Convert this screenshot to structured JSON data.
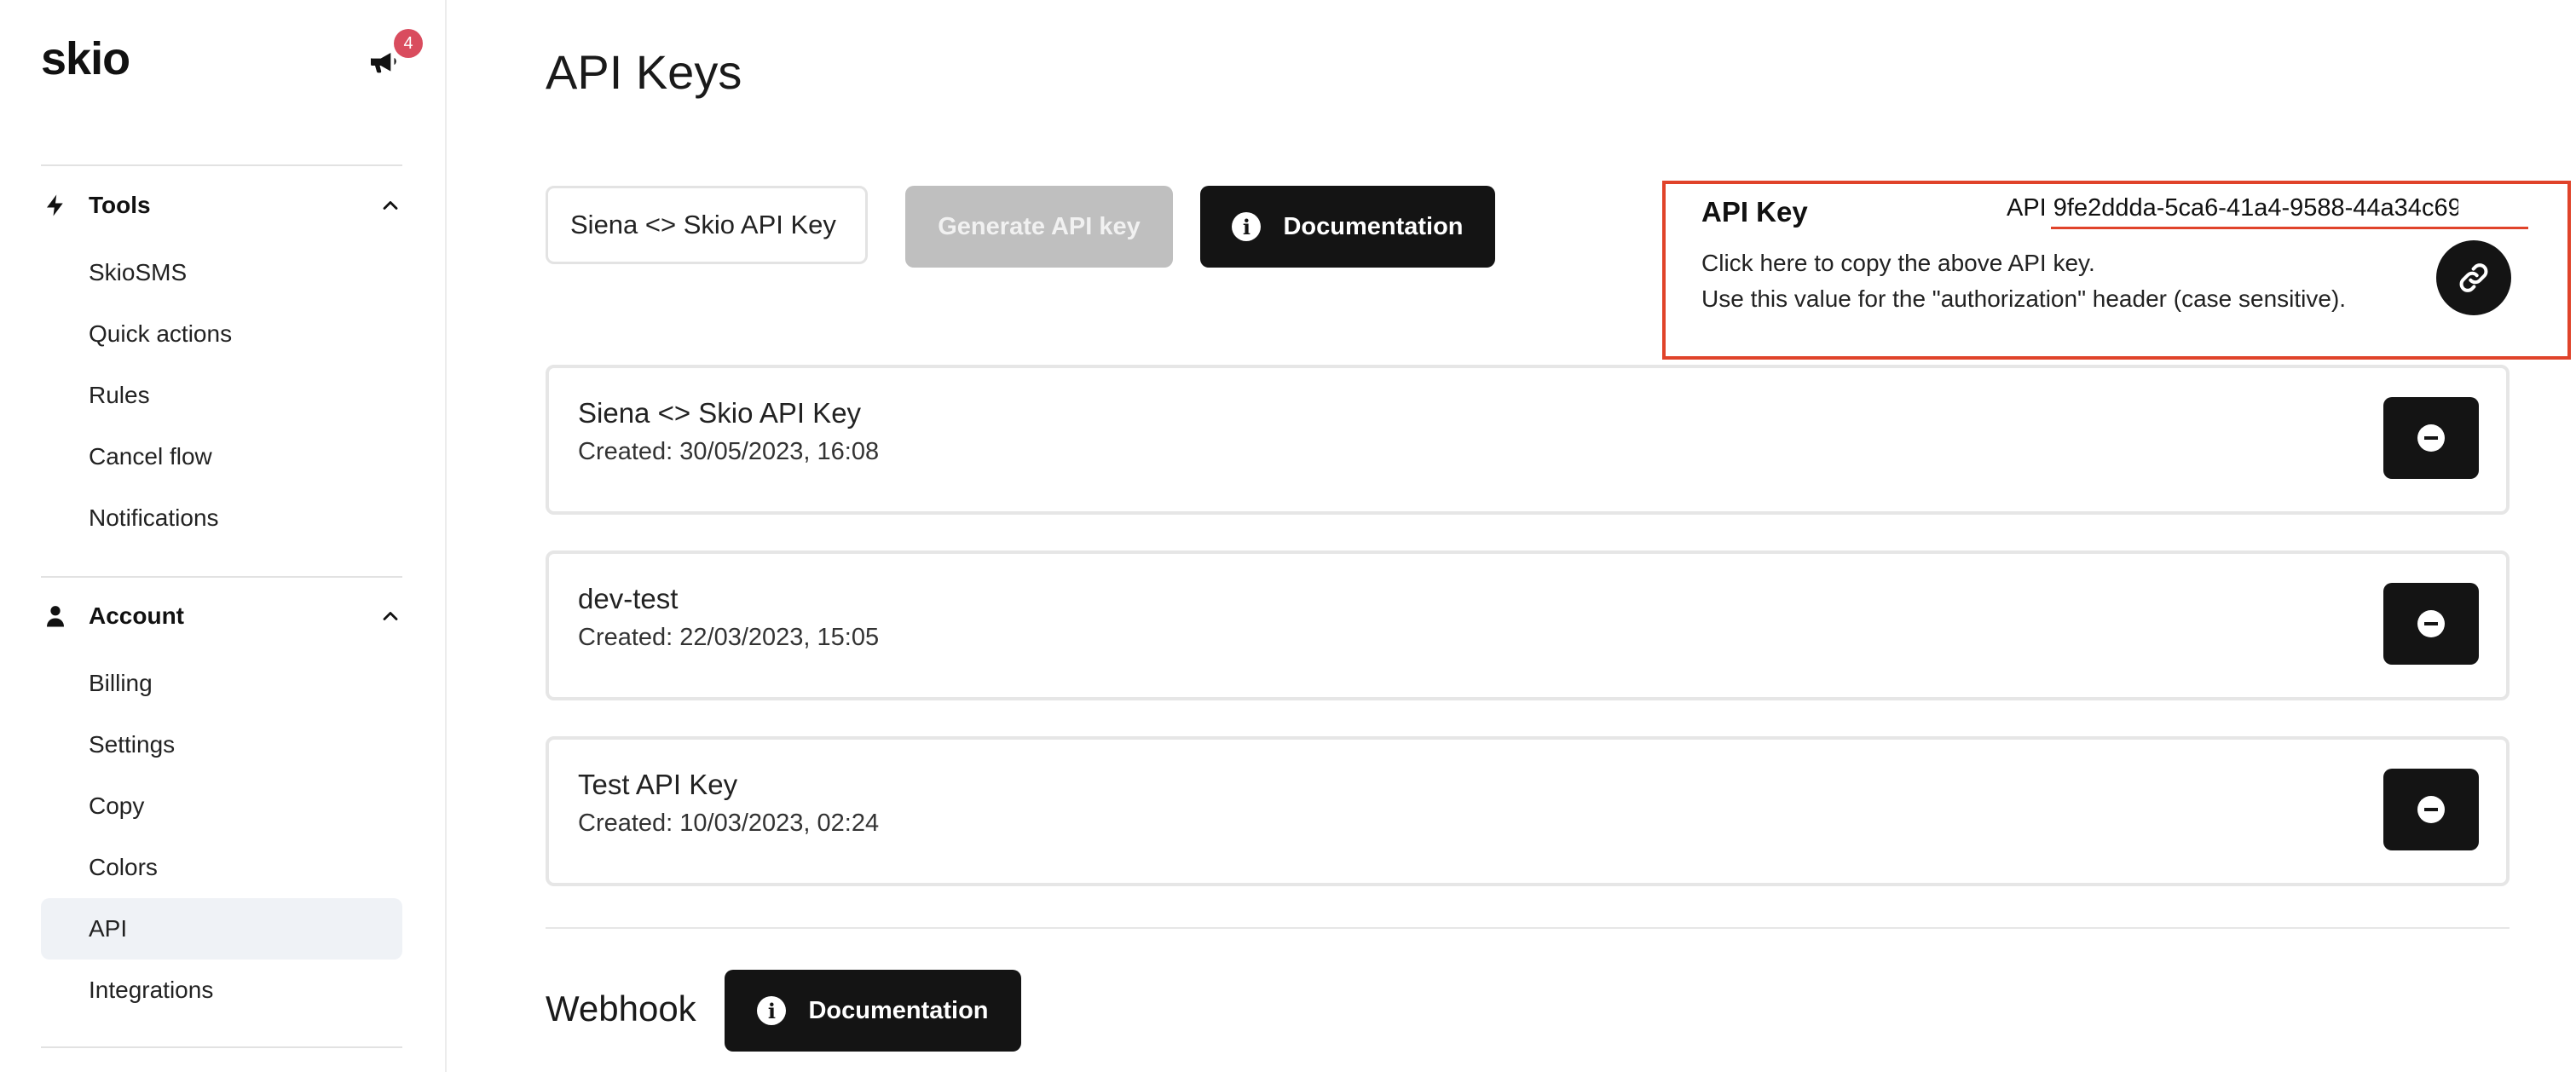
{
  "brand": {
    "logo": "skio"
  },
  "notifications": {
    "count": "4",
    "icon": "megaphone-icon"
  },
  "sidebar": {
    "tools": {
      "label": "Tools",
      "icon": "lightning-icon",
      "items": [
        {
          "label": "SkioSMS"
        },
        {
          "label": "Quick actions"
        },
        {
          "label": "Rules"
        },
        {
          "label": "Cancel flow"
        },
        {
          "label": "Notifications"
        }
      ]
    },
    "account": {
      "label": "Account",
      "icon": "user-icon",
      "items": [
        {
          "label": "Billing"
        },
        {
          "label": "Settings"
        },
        {
          "label": "Copy"
        },
        {
          "label": "Colors"
        },
        {
          "label": "API",
          "active": true
        },
        {
          "label": "Integrations"
        }
      ]
    }
  },
  "main": {
    "title": "API Keys",
    "key_name_input": {
      "value": "Siena <> Skio API Key"
    },
    "generate_label": "Generate API key",
    "documentation_label": "Documentation",
    "api_panel": {
      "label": "API Key",
      "value": "API 9fe2ddda-5ca6-41a4-9588-44a34c69",
      "copy_line1": "Click here to copy the above API key.",
      "copy_line2": "Use this value for the \"authorization\" header (case sensitive).",
      "highlight_color": "#e0432a"
    },
    "keys": [
      {
        "name": "Siena <> Skio API Key",
        "created": "Created: 30/05/2023, 16:08"
      },
      {
        "name": "dev-test",
        "created": "Created: 22/03/2023, 15:05"
      },
      {
        "name": "Test API Key",
        "created": "Created: 10/03/2023, 02:24"
      }
    ],
    "webhook": {
      "title": "Webhook",
      "documentation_label": "Documentation"
    }
  }
}
